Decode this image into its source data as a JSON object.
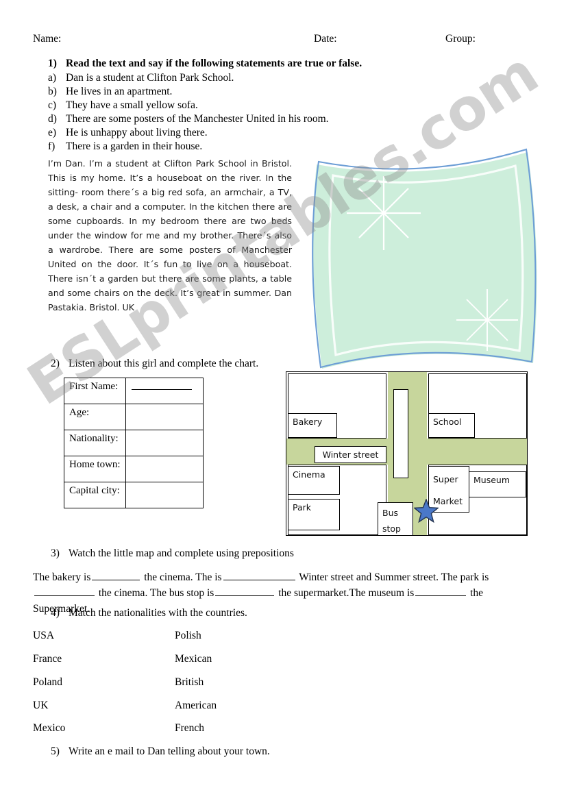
{
  "header": {
    "name_label": "Name:",
    "date_label": "Date:",
    "group_label": "Group:"
  },
  "exercise1": {
    "number": "1)",
    "title": "Read the text and say if the following statements are true or false.",
    "statements": [
      {
        "marker": "a)",
        "text": "Dan is a student at Clifton Park School."
      },
      {
        "marker": "b)",
        "text": "He lives in an apartment."
      },
      {
        "marker": "c)",
        "text": "They have a small yellow sofa."
      },
      {
        "marker": "d)",
        "text": "There are some posters of the Manchester United in his room."
      },
      {
        "marker": "e)",
        "text": "He is unhappy about living there."
      },
      {
        "marker": "f)",
        "text": "There is a garden in their house."
      }
    ],
    "passage": "I’m Dan. I’m a student at Clifton Park School in Bristol. This is my home. It’s a houseboat on the river. In the sitting- room there´s a big red sofa, an armchair, a TV, a desk, a chair and a computer. In the kitchen there are some cupboards. In my bedroom there are two beds under the window for me and my brother. There´s also a wardrobe. There are some posters of Manchester United on the door. It´s fun to live on a houseboat. There isn´t a garden but there are some plants, a table and some chairs on the deck. It’s great in summer. Dan Pastakia. Bristol. UK"
  },
  "exercise2": {
    "number": "2)",
    "title": "Listen about this girl and complete the chart.",
    "rows": [
      {
        "label": "First Name:",
        "value": ""
      },
      {
        "label": "Age:",
        "value": ""
      },
      {
        "label": "Nationality:",
        "value": ""
      },
      {
        "label": "Home town:",
        "value": ""
      },
      {
        "label": "Capital city:",
        "value": ""
      }
    ]
  },
  "map": {
    "buildings": [
      {
        "name": "bakery",
        "label": "Bakery"
      },
      {
        "name": "school",
        "label": "School"
      },
      {
        "name": "winter-street",
        "label": "Winter street"
      },
      {
        "name": "cinema",
        "label": "Cinema"
      },
      {
        "name": "park",
        "label": "Park"
      },
      {
        "name": "supermarket",
        "label": "Super\nMarket"
      },
      {
        "name": "supermarket-line1",
        "label": "Super"
      },
      {
        "name": "supermarket-line2",
        "label": "Market"
      },
      {
        "name": "museum",
        "label": "Museum"
      },
      {
        "name": "bus-stop-line1",
        "label": "Bus"
      },
      {
        "name": "bus-stop-line2",
        "label": "stop"
      }
    ],
    "colors": {
      "road": "#c7d69c",
      "star_fill": "#4a78c8",
      "star_stroke": "#22324f",
      "building_stroke": "#000000"
    }
  },
  "exercise3": {
    "number": "3)",
    "title": "Watch the little map and complete using prepositions",
    "sentence_parts": [
      "The bakery is",
      "the cinema. The is",
      "Winter street and Summer street. The park is",
      "the cinema. The bus stop is",
      "the supermarket.The museum is",
      "the Supermarket."
    ]
  },
  "exercise4": {
    "number": "4)",
    "title": "Match the nationalities with the countries.",
    "countries": [
      "USA",
      "France",
      "Poland",
      "UK",
      "Mexico"
    ],
    "nationalities": [
      "Polish",
      "Mexican",
      "British",
      "American",
      "French"
    ]
  },
  "exercise5": {
    "number": "5)",
    "title": "Write an e mail to Dan telling about your town."
  },
  "watermark": {
    "text": "ESLprintables.com"
  },
  "decoration": {
    "fill": "#cdeedb",
    "outline": "#6d9ed6",
    "sparkle": "#ffffff"
  }
}
